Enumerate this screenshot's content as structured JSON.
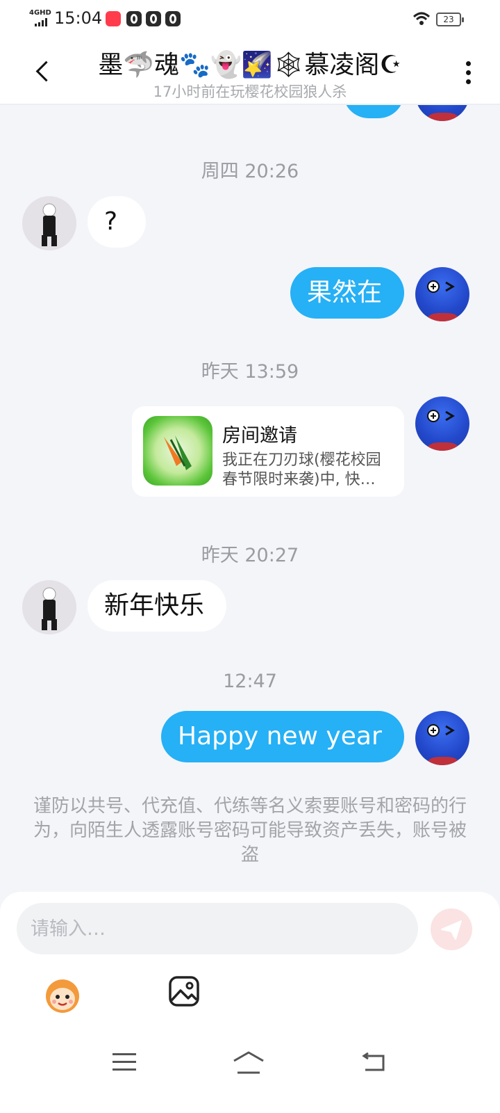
{
  "status_bar": {
    "network": "4GHD",
    "time": "15:04",
    "battery": "23"
  },
  "header": {
    "title": "墨🦈魂🐾👻🌠🕸慕凌阁☪",
    "subtitle": "17小时前在玩樱花校园狼人杀"
  },
  "messages": [
    {
      "type": "timestamp",
      "text": "周四 20:26"
    },
    {
      "type": "incoming",
      "text": "?"
    },
    {
      "type": "outgoing",
      "text": "果然在"
    },
    {
      "type": "timestamp",
      "text": "昨天 13:59"
    },
    {
      "type": "invite",
      "title": "房间邀请",
      "desc": "我正在刀刃球(樱花校园春节限时来袭)中, 快…"
    },
    {
      "type": "timestamp",
      "text": "昨天 20:27"
    },
    {
      "type": "incoming",
      "text": "新年快乐"
    },
    {
      "type": "timestamp",
      "text": "12:47"
    },
    {
      "type": "outgoing",
      "text": "Happy new year"
    }
  ],
  "warning": "谨防以共号、代充值、代练等名义索要账号和密码的行为，向陌生人透露账号密码可能导致资产丢失，账号被盗",
  "input": {
    "placeholder": "请输入…",
    "value": ""
  },
  "icons": {
    "back": "back-chevron-icon",
    "more": "more-vertical-icon",
    "send": "send-icon",
    "emoji": "emoji-icon",
    "image": "image-icon",
    "nav_menu": "menu-icon",
    "nav_home": "home-icon",
    "nav_back": "back-icon"
  },
  "colors": {
    "outgoing_bubble": "#26b0f5",
    "incoming_bubble": "#ffffff",
    "background": "#f3f5f9",
    "send_button": "#fbe3e3"
  }
}
